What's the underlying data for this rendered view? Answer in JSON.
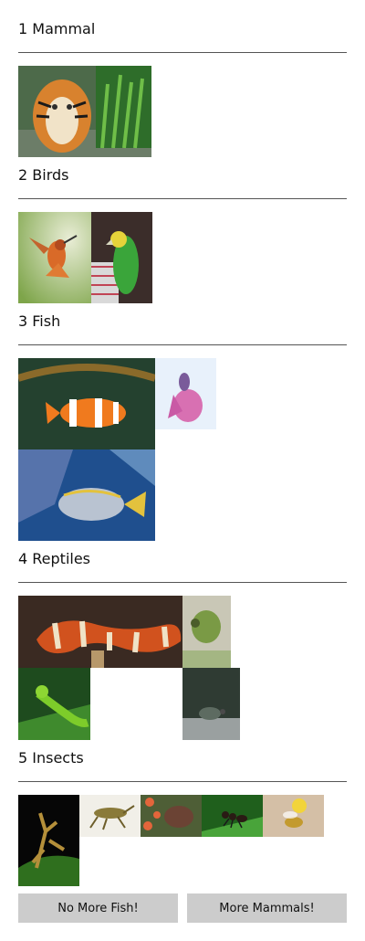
{
  "groups": [
    {
      "heading": "1 Mammal",
      "images": [
        {
          "icon": "tiger-photo"
        }
      ]
    },
    {
      "heading": "2 Birds",
      "images": [
        {
          "icon": "hummingbird-photo"
        },
        {
          "icon": "parrot-photo"
        }
      ]
    },
    {
      "heading": "3 Fish",
      "images": [
        {
          "icon": "clownfish-photo"
        },
        {
          "icon": "betta-fish-photo"
        },
        {
          "icon": "tang-fish-photo"
        }
      ]
    },
    {
      "heading": "4 Reptiles",
      "images": [
        {
          "icon": "snake-photo"
        },
        {
          "icon": "chameleon-photo"
        },
        {
          "icon": "lizard-photo"
        },
        {
          "icon": "turtle-photo"
        }
      ]
    },
    {
      "heading": "5 Insects",
      "images": [
        {
          "icon": "mantis-photo"
        },
        {
          "icon": "grasshopper-photo"
        },
        {
          "icon": "butterfly-photo"
        },
        {
          "icon": "ant-photo"
        },
        {
          "icon": "bee-photo"
        }
      ]
    }
  ],
  "buttons": {
    "no_more_fish": "No More Fish!",
    "more_mammals": "More Mammals!"
  },
  "colors": {
    "button_bg": "#cccccc",
    "divider": "#555555"
  }
}
